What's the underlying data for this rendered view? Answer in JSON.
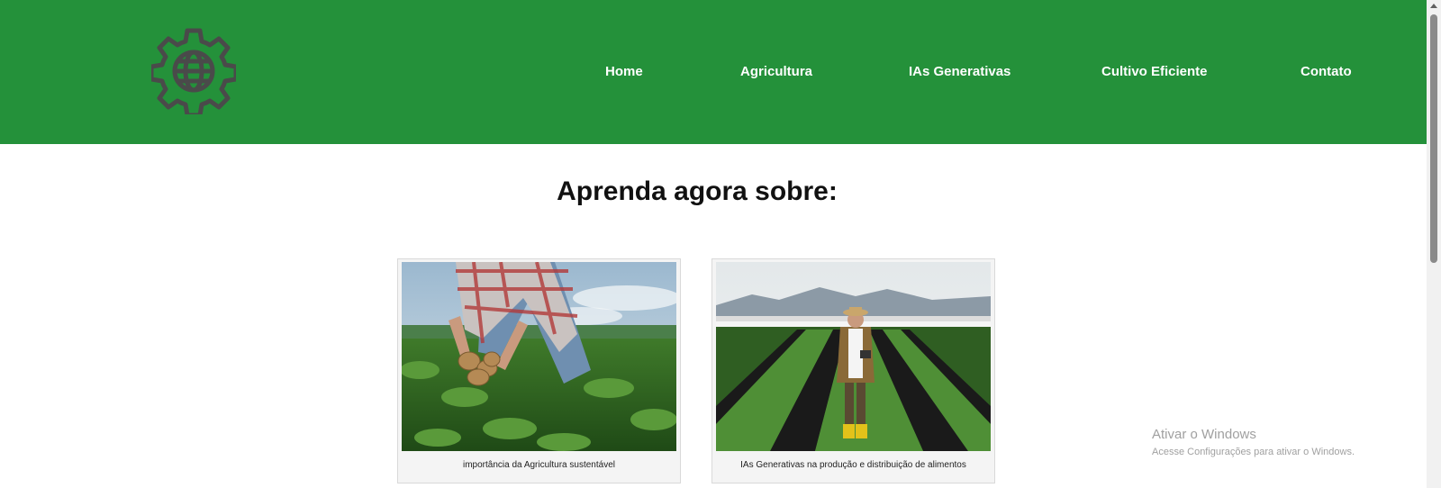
{
  "header": {
    "logo_icon": "gear-globe-icon",
    "bg_color": "#24913a"
  },
  "nav": {
    "items": [
      {
        "label": "Home"
      },
      {
        "label": "Agricultura"
      },
      {
        "label": "IAs Generativas"
      },
      {
        "label": "Cultivo Eficiente"
      },
      {
        "label": "Contato"
      }
    ]
  },
  "main": {
    "title": "Aprenda agora sobre:",
    "cards": [
      {
        "caption": "importância da Agricultura sustentável",
        "image": "farmer-holding-potatoes-photo"
      },
      {
        "caption": "IAs Generativas na produção e distribuição de alimentos",
        "image": "farmer-with-tablet-in-field-photo"
      }
    ]
  },
  "watermark": {
    "line1": "Ativar o Windows",
    "line2": "Acesse Configurações para ativar o Windows."
  }
}
